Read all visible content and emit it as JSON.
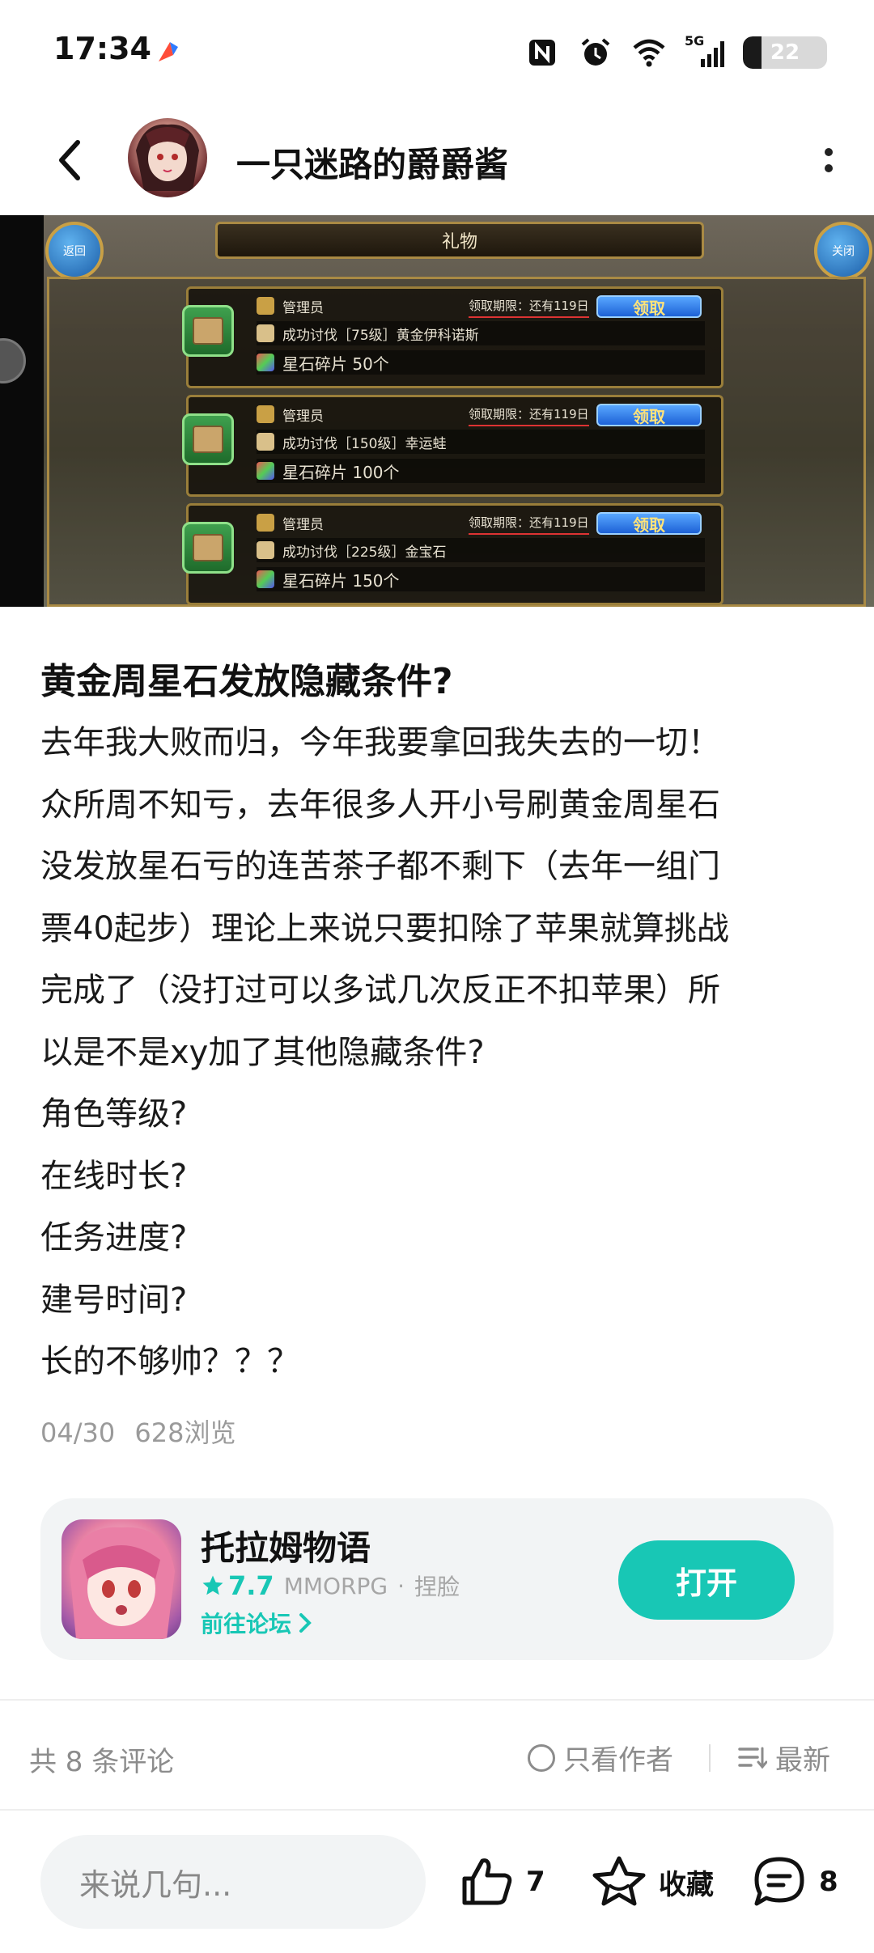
{
  "status_bar": {
    "time": "17:34",
    "network": "5G",
    "battery_level": "22",
    "battery_fraction": 0.22,
    "icons": [
      "app-notification-icon",
      "nfc-icon",
      "alarm-icon",
      "wifi-icon",
      "signal-icon",
      "battery-icon"
    ]
  },
  "header": {
    "author_name": "一只迷路的爵爵酱",
    "back_icon": "chevron-left-icon",
    "more_icon": "more-vertical-icon"
  },
  "post_image": {
    "title": "礼物",
    "left_button": "返回",
    "right_button": "关闭",
    "gifts": [
      {
        "sender": "管理员",
        "deadline": "领取期限：还有119日",
        "claim": "领取",
        "reason": "成功讨伐［75级］黄金伊科诺斯",
        "reward": "星石碎片  50个"
      },
      {
        "sender": "管理员",
        "deadline": "领取期限：还有119日",
        "claim": "领取",
        "reason": "成功讨伐［150级］幸运蛙",
        "reward": "星石碎片  100个"
      },
      {
        "sender": "管理员",
        "deadline": "领取期限：还有119日",
        "claim": "领取",
        "reason": "成功讨伐［225级］金宝石",
        "reward": "星石碎片  150个"
      }
    ]
  },
  "post": {
    "title": "黄金周星石发放隐藏条件?",
    "lines": [
      "去年我大败而归，今年我要拿回我失去的一切！",
      "众所周不知亏，去年很多人开小号刷黄金周星石",
      "没发放星石亏的连苦茶子都不剩下（去年一组门",
      "票40起步）理论上来说只要扣除了苹果就算挑战",
      "完成了（没打过可以多试几次反正不扣苹果）所",
      "以是不是xy加了其他隐藏条件?",
      "角色等级?",
      "在线时长?",
      "任务进度?",
      "建号时间?",
      "长的不够帅？？？"
    ],
    "date": "04/30",
    "views": "628浏览"
  },
  "game_card": {
    "name": "托拉姆物语",
    "rating": "7.7",
    "genre": "MMORPG",
    "separator": "·",
    "tag": "捏脸",
    "forum_link": "前往论坛",
    "open_label": "打开",
    "accent_color": "#18c7b5"
  },
  "comments_bar": {
    "count_label": "共 8 条评论",
    "author_only_label": "只看作者",
    "sort_label": "最新"
  },
  "bottom_bar": {
    "input_placeholder": "来说几句...",
    "like_count": "7",
    "favorite_label": "收藏",
    "comment_count": "8"
  }
}
